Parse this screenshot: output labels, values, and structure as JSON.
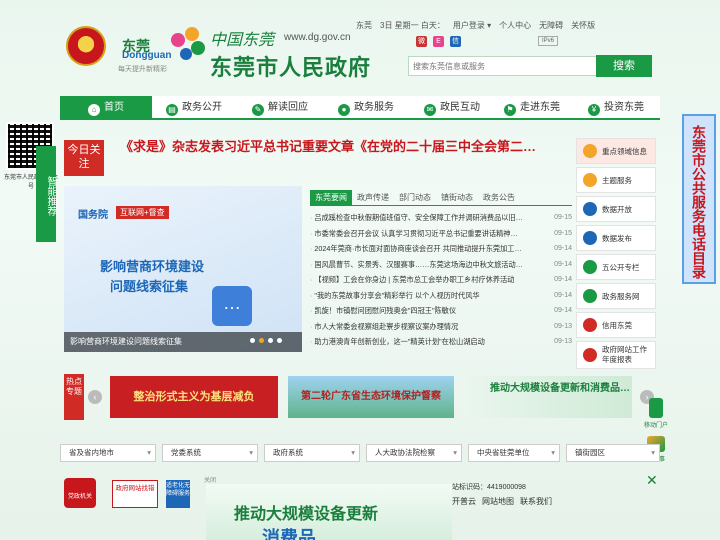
{
  "header": {
    "emblem_caption": "",
    "logo_text": "东莞",
    "logo_sub": "Dongguan",
    "logo_slogan": "每天提升新精彩",
    "cn_calligraphy": "中国东莞",
    "site_url": "www.dg.gov.cn",
    "gov_title": "东莞市人民政府",
    "top_links": [
      "东莞",
      "3日 星期一 白天：",
      "用户登录 ▾",
      "个人中心",
      "无障碍",
      "关怀版"
    ],
    "ipv6": "IPv6",
    "search_placeholder": "搜索东莞信息或服务",
    "search_button": "搜索"
  },
  "nav": {
    "items": [
      "首页",
      "政务公开",
      "解读回应",
      "政务服务",
      "政民互动",
      "走进东莞",
      "投资东莞"
    ]
  },
  "left": {
    "qr_caption": "东莞市人民政府公众号",
    "smart_push": "智能推荐"
  },
  "today": {
    "badge": "今日关注",
    "headline": "《求是》杂志发表习近平总书记重要文章《在党的二十届三中全会第二…"
  },
  "banner": {
    "tag_a": "国务院",
    "tag_b": "互联网+督查",
    "title1": "影响营商环境建设",
    "title2": "问题线索征集",
    "caption": "影响营商环境建设问题线索征集",
    "slide_index": 1,
    "slide_count": 4
  },
  "news": {
    "tabs": [
      "东莞要闻",
      "政声传递",
      "部门动态",
      "镇街动态",
      "政务公告"
    ],
    "active_tab": 0,
    "items": [
      {
        "title": "吕成蹊检查中秋假期值班值守、安全保障工作并调研消费品以旧…",
        "date": "09-15"
      },
      {
        "title": "市委常委会召开会议 认真学习贯彻习近平总书记重要讲话精神…",
        "date": "09-15"
      },
      {
        "title": "2024年莞商·市长面对面协商座谈会召开 共同推动提升东莞加工…",
        "date": "09-14"
      },
      {
        "title": "国风晨曹节、实景秀、汉服赛事……东莞这场海边中秋文旅活动…",
        "date": "09-14"
      },
      {
        "title": "【视频】工会在你身边 | 东莞市总工会举办职工乡村疗休养活动",
        "date": "09-14"
      },
      {
        "title": "\"我的东莞故事分享会\"精彩举行 以个人视历时代风华",
        "date": "09-14"
      },
      {
        "title": "凯旋！市镇慰问团慰问残奥会\"四冠王\"陈敏仪",
        "date": "09-14"
      },
      {
        "title": "市人大常委会视察组赴寮步视察议案办理情况",
        "date": "09-13"
      },
      {
        "title": "助力港澳青年创新创业，这一\"精英计划\"在松山湖启动",
        "date": "09-13"
      }
    ]
  },
  "services": {
    "items": [
      "重点领域信息",
      "主题服务",
      "数据开放",
      "数据发布",
      "五公开专栏",
      "政务服务网",
      "信用东莞",
      "政府网站工作年度报表"
    ]
  },
  "hotline": "东莞市公共服务电话目录",
  "topics": {
    "badge": "热点专题",
    "cards": [
      "整治形式主义为基层减负",
      "第二轮广东省生态环境保护督察",
      "推动大规模设备更新和消费品…"
    ],
    "prev": "‹",
    "next": "›"
  },
  "side_apps": {
    "mobile_portal": "移动门户",
    "yue_app": "粤省事",
    "close": "✕"
  },
  "link_selects": [
    "省及省内地市",
    "党委系统",
    "政府系统",
    "人大政协法院检察",
    "中央省驻莞单位",
    "镇街园区"
  ],
  "footer": {
    "badge_party": "党政机关",
    "badge_correct": "政府网站找错",
    "badge_access": "适老化无障碍服务",
    "close": "关闭",
    "site_id": "站标识码：4419000098",
    "links": [
      "开普云",
      "网站地图",
      "联系我们"
    ]
  },
  "float_ad": {
    "line1": "推动大规模设备更新",
    "line2": "消费品"
  },
  "colors": {
    "primary_green": "#1a9a45",
    "accent_red": "#d12b26",
    "accent_blue": "#1d67b6",
    "accent_orange": "#f2a52a"
  }
}
